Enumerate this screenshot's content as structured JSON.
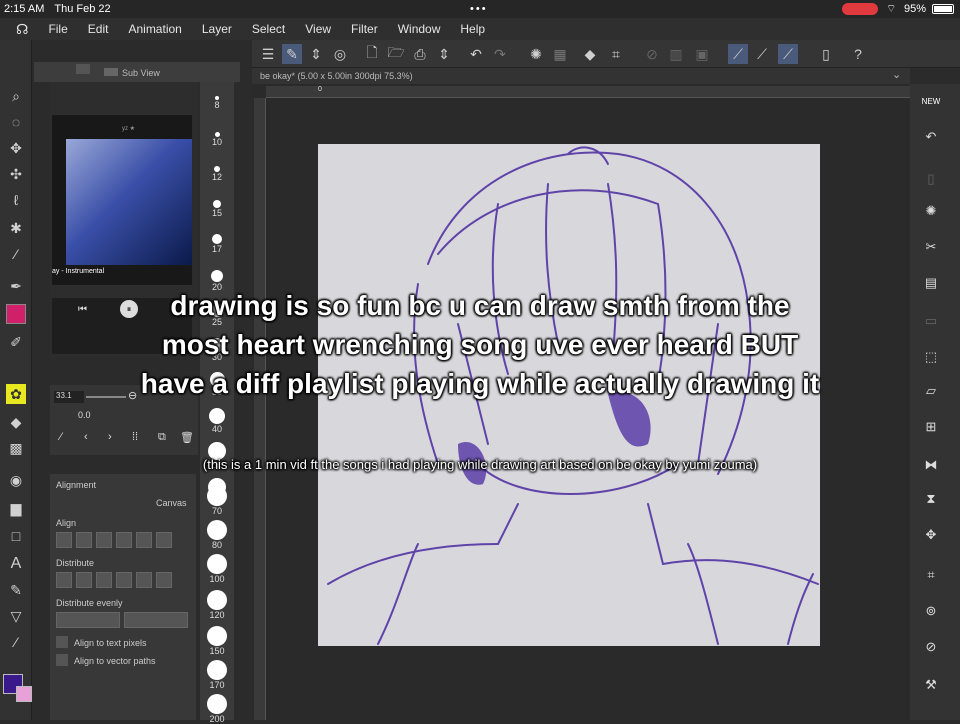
{
  "status": {
    "time": "2:15 AM",
    "date": "Thu Feb 22",
    "battery": "95%"
  },
  "menu": [
    "File",
    "Edit",
    "Animation",
    "Layer",
    "Select",
    "View",
    "Filter",
    "Window",
    "Help"
  ],
  "document_tab": "be okay* (5.00 x 5.00in 300dpi 75.3%)",
  "subview": {
    "title": "Sub View",
    "song": "ay - Instrumental"
  },
  "nav": {
    "angle": "33.1",
    "zoom": "0.0"
  },
  "brush_sizes": [
    "8",
    "10",
    "12",
    "15",
    "17",
    "20",
    "25",
    "30",
    "35",
    "40",
    "50",
    "60",
    "70",
    "80",
    "100",
    "120",
    "150",
    "170",
    "200"
  ],
  "align_panel": {
    "alignment_label": "Alignment",
    "target": "Canvas",
    "align": "Align",
    "distribute": "Distribute",
    "distribute_evenly": "Distribute evenly",
    "text_pixels": "Align to text pixels",
    "vector_paths": "Align to vector paths"
  },
  "caption_main": "drawing is so fun bc u can draw smth from the most heart wrenching song uve ever heard BUT have a diff playlist playing while actually drawing it",
  "caption_sub": "(this is a 1 min vid ft the songs i had playing while drawing art based on be okay by yumi zouma)",
  "ruler_zero": "0",
  "colors": {
    "main": "#3a1a8a",
    "sub": "#e8a0d8",
    "stroke": "#4b2aa0",
    "record": "#e0393e"
  }
}
